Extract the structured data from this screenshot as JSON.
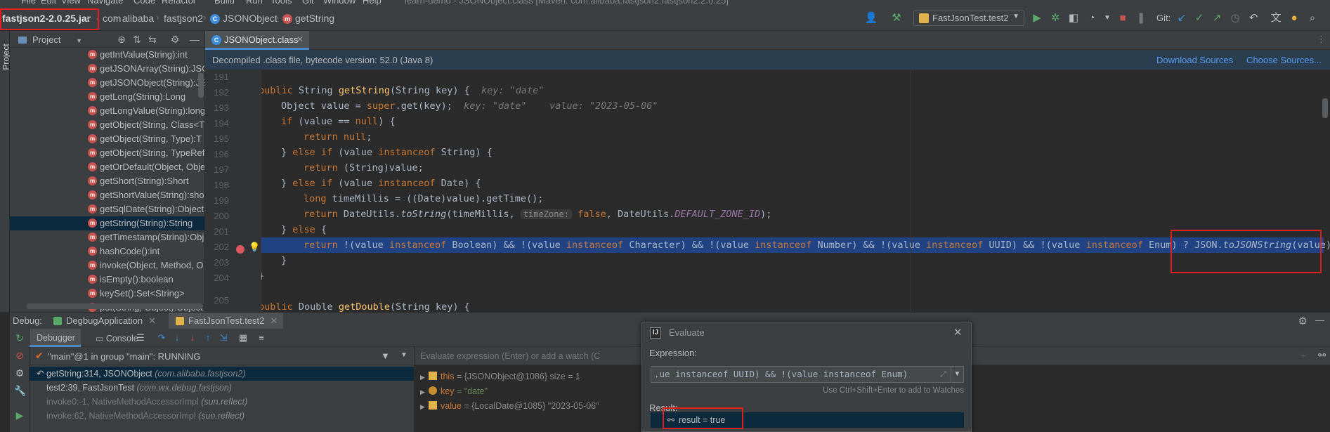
{
  "menu": [
    "File",
    "Edit",
    "View",
    "Navigate",
    "Code",
    "Refactor",
    "Build",
    "Run",
    "Tools",
    "Git",
    "Window",
    "Help"
  ],
  "window_title": "learn-demo - JSONObject.class [Maven: com.alibaba.fastjson2:fastjson2:2.0.25]",
  "breadcrumb": {
    "jar": "fastjson2-2.0.25.jar",
    "items": [
      "com",
      "alibaba",
      "fastjson2",
      "JSONObject",
      "getString"
    ]
  },
  "toolbar": {
    "run_config": "FastJsonTest.test2",
    "git_label": "Git:"
  },
  "left_strip_label": "Project",
  "project": {
    "title": "Project",
    "methods": [
      {
        "label": "getIntValue(String):int",
        "selected": false
      },
      {
        "label": "getJSONArray(String):JSO",
        "selected": false
      },
      {
        "label": "getJSONObject(String):JS",
        "selected": false
      },
      {
        "label": "getLong(String):Long",
        "selected": false
      },
      {
        "label": "getLongValue(String):long",
        "selected": false
      },
      {
        "label": "getObject(String, Class<T",
        "selected": false
      },
      {
        "label": "getObject(String, Type):T",
        "selected": false
      },
      {
        "label": "getObject(String, TypeRef",
        "selected": false
      },
      {
        "label": "getOrDefault(Object, Obje",
        "selected": false
      },
      {
        "label": "getShort(String):Short",
        "selected": false
      },
      {
        "label": "getShortValue(String):sho",
        "selected": false
      },
      {
        "label": "getSqlDate(String):Object",
        "selected": false
      },
      {
        "label": "getString(String):String",
        "selected": true
      },
      {
        "label": "getTimestamp(String):Obj",
        "selected": false
      },
      {
        "label": "hashCode():int",
        "selected": false
      },
      {
        "label": "invoke(Object, Method, O",
        "selected": false
      },
      {
        "label": "isEmpty():boolean",
        "selected": false
      },
      {
        "label": "keySet():Set<String>",
        "selected": false
      },
      {
        "label": "put(String, Object):Object",
        "selected": false
      }
    ]
  },
  "editor": {
    "tab_label": "JSONObject.class",
    "decompiled_notice": "Decompiled .class file, bytecode version: 52.0 (Java 8)",
    "download_sources": "Download Sources",
    "choose_sources": "Choose Sources...",
    "line_numbers": [
      "191",
      "192",
      "193",
      "194",
      "195",
      "196",
      "197",
      "198",
      "199",
      "200",
      "201",
      "202",
      "203",
      "204",
      "205"
    ],
    "hints": {
      "key_hint": "key: \"date\"",
      "value_hint": "value: \"2023-05-06\"",
      "timezone_hint": "timeZone:"
    }
  },
  "debug": {
    "label": "Debug:",
    "tabs": [
      "DegbugApplication",
      "FastJsonTest.test2"
    ],
    "subtabs": [
      "Debugger",
      "Console"
    ],
    "thread": "\"main\"@1 in group \"main\": RUNNING",
    "frames": [
      {
        "method": "getString:314, JSONObject",
        "pkg": "(com.alibaba.fastjson2)",
        "selected": true,
        "dim": false
      },
      {
        "method": "test2:39, FastJsonTest",
        "pkg": "(com.wx.debug.fastjson)",
        "selected": false,
        "dim": false
      },
      {
        "method": "invoke0:-1, NativeMethodAccessorImpl",
        "pkg": "(sun.reflect)",
        "selected": false,
        "dim": true
      },
      {
        "method": "invoke:62, NativeMethodAccessorImpl",
        "pkg": "(sun.reflect)",
        "selected": false,
        "dim": true
      }
    ],
    "eval_placeholder": "Evaluate expression (Enter) or add a watch (C",
    "variables": [
      {
        "name": "this",
        "value": "= {JSONObject@1086}  size = 1"
      },
      {
        "name": "key",
        "value": "= \"date\""
      },
      {
        "name": "value",
        "value": "= {LocalDate@1085} \"2023-05-06\""
      }
    ]
  },
  "evaluate": {
    "title": "Evaluate",
    "expression_label": "Expression:",
    "expression_text": ".ue instanceof UUID) && !(value instanceof Enum)",
    "hint": "Use Ctrl+Shift+Enter to add to Watches",
    "result_label": "Result:",
    "result_value": "result = true"
  },
  "colors": {
    "highlight": "#e0201e",
    "selection": "#214283",
    "keyword": "#cc7832",
    "method": "#ffc66d",
    "string": "#6a8759",
    "accent": "#4a88c7"
  }
}
